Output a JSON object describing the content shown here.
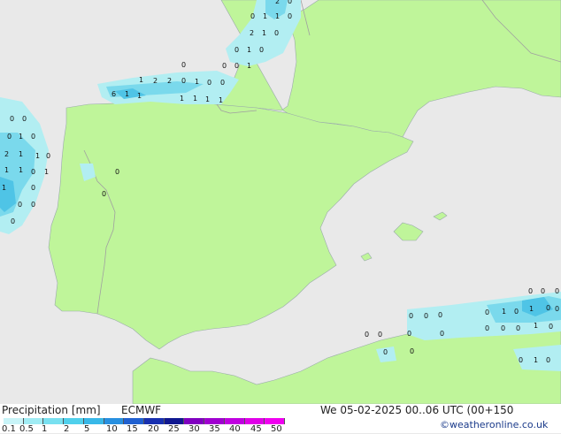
{
  "footer": {
    "title": "Precipitation [mm]",
    "model": "ECMWF",
    "datetime": "We 05-02-2025 00..06 UTC (00+150",
    "credit": "©weatheronline.co.uk"
  },
  "legend": {
    "ticks": [
      "0.1",
      "0.5",
      "1",
      "2",
      "5",
      "10",
      "15",
      "20",
      "25",
      "30",
      "35",
      "40",
      "45",
      "50"
    ],
    "colors": [
      "#c8f4f8",
      "#a0ecf4",
      "#78e0f0",
      "#50d0ec",
      "#38b8e8",
      "#2890e0",
      "#2060d0",
      "#1830b0",
      "#101890",
      "#8000c0",
      "#a000d0",
      "#c000e0",
      "#e000e8",
      "#f000f0"
    ]
  },
  "colors": {
    "land": "#bff59a",
    "sea": "#e9e9e9",
    "border": "#a0a0a0",
    "rain_light": "#b2eef2",
    "rain_mid": "#7ad9ec",
    "rain_heavy": "#4fc4e6"
  },
  "precip_values": [
    "2",
    "0",
    "0",
    "1",
    "1",
    "0",
    "2",
    "1",
    "0",
    "0",
    "1",
    "0",
    "0",
    "0",
    "1",
    "0",
    "1",
    "2",
    "2",
    "0",
    "1",
    "0",
    "0",
    "1",
    "6",
    "1",
    "1",
    "1",
    "1",
    "1",
    "0",
    "0",
    "0",
    "1",
    "0",
    "1",
    "2",
    "1",
    "0",
    "1",
    "1",
    "0",
    "1",
    "0",
    "1",
    "0",
    "0",
    "0",
    "0",
    "0",
    "0",
    "0",
    "0",
    "0",
    "0",
    "0",
    "1",
    "0",
    "0",
    "0",
    "0",
    "0",
    "1",
    "0",
    "0",
    "0",
    "0",
    "1",
    "0",
    "0",
    "0",
    "0",
    "1",
    "0",
    "0",
    "0",
    "0"
  ]
}
